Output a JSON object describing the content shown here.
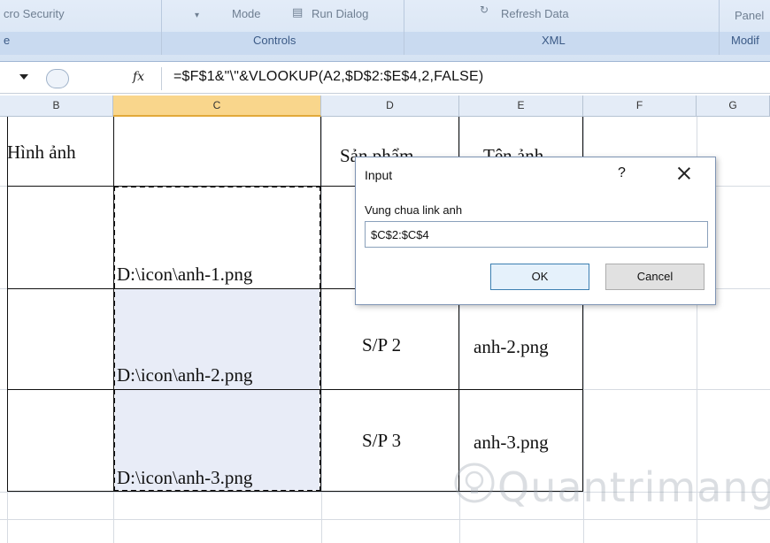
{
  "ribbon": {
    "items": [
      "cro Security",
      "Mode",
      "Run Dialog",
      "Refresh Data",
      "Panel"
    ],
    "groups": [
      "e",
      "Controls",
      "XML",
      "Modif"
    ]
  },
  "formula_bar": {
    "fx_label": "fx",
    "formula": "=$F$1&\"\\\"&VLOOKUP(A2,$D$2:$E$4,2,FALSE)"
  },
  "columns": [
    "B",
    "C",
    "D",
    "E",
    "F",
    "G"
  ],
  "sheet": {
    "b1": "Hình ảnh",
    "d1": "Sản phẩm",
    "e1": "Tên ảnh",
    "c2": "D:\\icon\\anh-1.png",
    "c3": "D:\\icon\\anh-2.png",
    "d3": "S/P 2",
    "e3": "anh-2.png",
    "c4": "D:\\icon\\anh-3.png",
    "d4": "S/P 3",
    "e4": "anh-3.png"
  },
  "dialog": {
    "title": "Input",
    "help": "?",
    "prompt": "Vung chua link anh",
    "value": "$C$2:$C$4",
    "ok": "OK",
    "cancel": "Cancel"
  }
}
